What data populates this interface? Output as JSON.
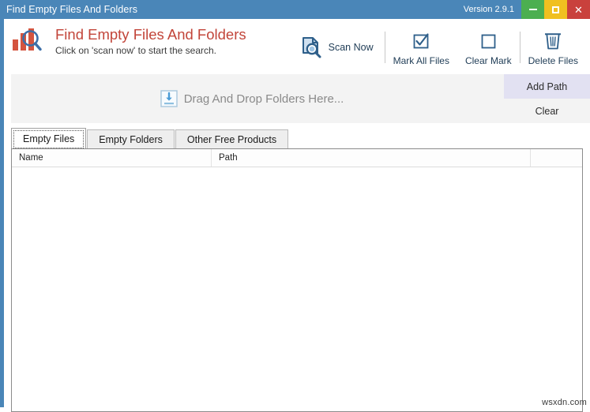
{
  "titlebar": {
    "title": "Find Empty Files And Folders",
    "version": "Version 2.9.1",
    "minimize_label": "–",
    "maximize_label": "",
    "close_label": "✕",
    "colors": {
      "background": "#4a86b8",
      "minimize": "#4caf50",
      "maximize": "#f0c020",
      "close": "#c9413c"
    }
  },
  "header": {
    "logo_icon": "bar-chart-magnifier-icon",
    "title": "Find Empty Files And Folders",
    "subtitle": "Click on 'scan now' to start the search.",
    "title_color": "#c2453a"
  },
  "toolbar": {
    "items": [
      {
        "label": "Scan Now",
        "icon": "document-search-icon"
      },
      {
        "label": "Mark All Files",
        "icon": "checkbox-checked-icon"
      },
      {
        "label": "Clear Mark",
        "icon": "checkbox-empty-icon"
      },
      {
        "label": "Delete Files",
        "icon": "trash-can-icon"
      }
    ]
  },
  "dropzone": {
    "text": "Drag And Drop Folders Here...",
    "icon": "drop-download-icon",
    "background": "#f3f3f3"
  },
  "side_buttons": {
    "add_path": "Add Path",
    "clear": "Clear",
    "add_path_color": "#e2e1f2",
    "clear_color": "#f3f3f3"
  },
  "tabs": {
    "active_index": 0,
    "items": [
      {
        "label": "Empty Files"
      },
      {
        "label": "Empty Folders"
      },
      {
        "label": "Other Free Products"
      }
    ]
  },
  "listview": {
    "columns": [
      {
        "label": "Name"
      },
      {
        "label": "Path"
      },
      {
        "label": ""
      }
    ],
    "rows": []
  },
  "watermark": {
    "text": "wsxdn.com"
  }
}
